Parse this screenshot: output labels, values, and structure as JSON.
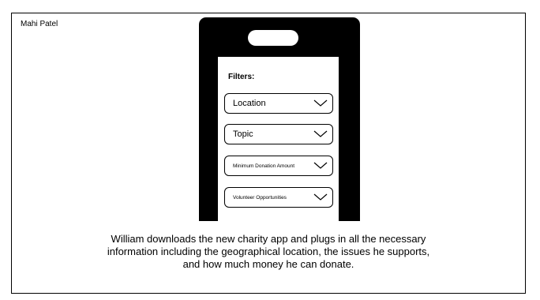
{
  "author": "Mahi Patel",
  "filters": {
    "title": "Filters:",
    "dropdowns": [
      {
        "label": "Location",
        "size": "normal"
      },
      {
        "label": "Topic",
        "size": "normal"
      },
      {
        "label": "Minimum Donation Amount",
        "size": "small"
      },
      {
        "label": "Volunteer Opportunities",
        "size": "small"
      }
    ]
  },
  "caption": {
    "line1": "William downloads the new charity app and plugs in all the necessary",
    "line2": "information including the geographical location, the issues he supports,",
    "line3": "and how much money he can donate."
  },
  "icons": {
    "dropdown": "chevron-down-icon"
  },
  "colors": {
    "phone": "#000000",
    "background": "#ffffff"
  }
}
